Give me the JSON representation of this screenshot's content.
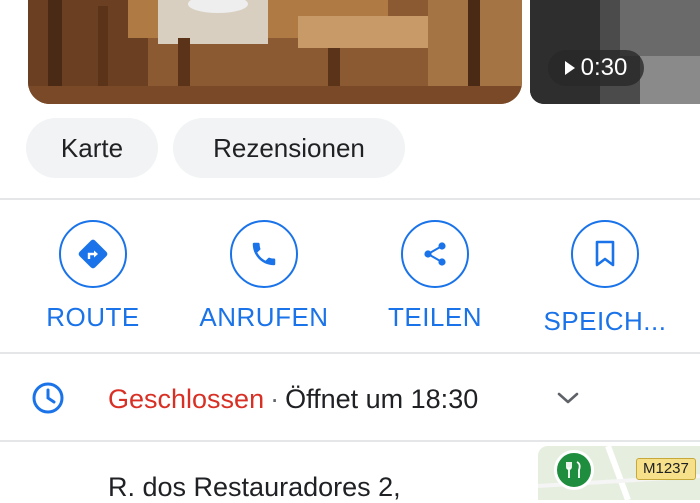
{
  "media": {
    "video_duration": "0:30"
  },
  "chips": {
    "map": "Karte",
    "reviews": "Rezensionen"
  },
  "actions": [
    {
      "label": "ROUTE",
      "icon": "directions-icon"
    },
    {
      "label": "ANRUFEN",
      "icon": "phone-icon"
    },
    {
      "label": "TEILEN",
      "icon": "share-icon"
    },
    {
      "label": "SPEICH...",
      "icon": "bookmark-icon"
    }
  ],
  "hours": {
    "status": "Geschlossen",
    "separator": "·",
    "opens": "Öffnet um 18:30",
    "icon": "clock-icon"
  },
  "address": {
    "line1": "R. dos Restauradores 2,"
  },
  "mini_map": {
    "road_label": "M1237",
    "icon": "restaurant-pin-icon"
  },
  "colors": {
    "accent": "#1a73e8",
    "closed": "#d93025",
    "chip_bg": "#f1f3f4",
    "text": "#202124"
  }
}
